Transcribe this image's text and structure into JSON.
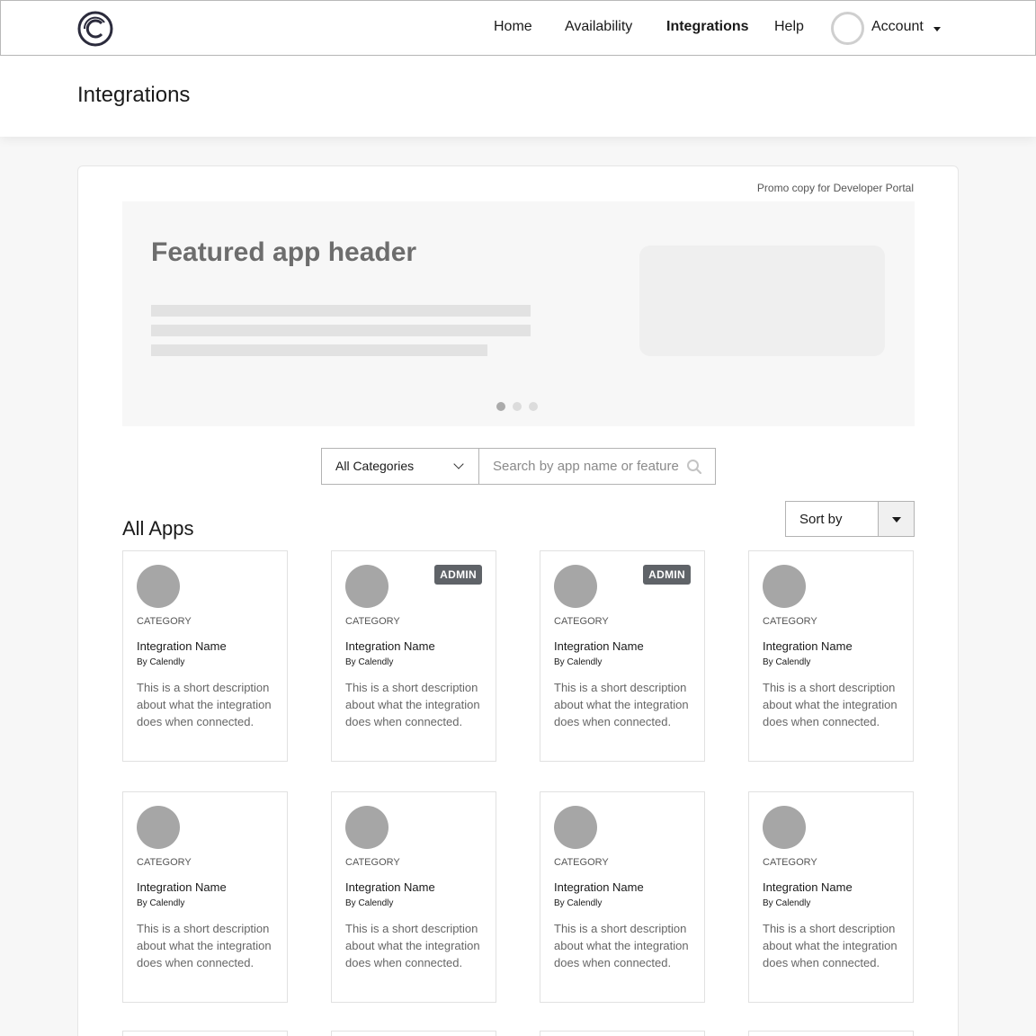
{
  "nav": {
    "items": [
      {
        "label": "Home",
        "active": false
      },
      {
        "label": "Availability",
        "active": false
      },
      {
        "label": "Integrations",
        "active": true
      },
      {
        "label": "Help",
        "active": false
      }
    ],
    "account_label": "Account"
  },
  "header": {
    "title": "Integrations"
  },
  "promo": {
    "copy": "Promo copy for Developer Portal"
  },
  "featured": {
    "header": "Featured app header",
    "slides": 3,
    "active_slide": 1
  },
  "filters": {
    "category_selected": "All Categories",
    "search_placeholder": "Search by app name or feature"
  },
  "apps_section": {
    "title": "All Apps",
    "sort_label": "Sort by"
  },
  "apps": [
    {
      "category": "CATEGORY",
      "name": "Integration Name",
      "by": "By Calendly",
      "description": "This is a short description about what the integration does when connected.",
      "badge": ""
    },
    {
      "category": "CATEGORY",
      "name": "Integration Name",
      "by": "By Calendly",
      "description": "This is a short description about what the integration does when connected.",
      "badge": "ADMIN"
    },
    {
      "category": "CATEGORY",
      "name": "Integration Name",
      "by": "By Calendly",
      "description": "This is a short description about what the integration does when connected.",
      "badge": "ADMIN"
    },
    {
      "category": "CATEGORY",
      "name": "Integration Name",
      "by": "By Calendly",
      "description": "This is a short description about what the integration does when connected.",
      "badge": ""
    },
    {
      "category": "CATEGORY",
      "name": "Integration Name",
      "by": "By Calendly",
      "description": "This is a short description about what the integration does when connected.",
      "badge": ""
    },
    {
      "category": "CATEGORY",
      "name": "Integration Name",
      "by": "By Calendly",
      "description": "This is a short description about what the integration does when connected.",
      "badge": ""
    },
    {
      "category": "CATEGORY",
      "name": "Integration Name",
      "by": "By Calendly",
      "description": "This is a short description about what the integration does when connected.",
      "badge": ""
    },
    {
      "category": "CATEGORY",
      "name": "Integration Name",
      "by": "By Calendly",
      "description": "This is a short description about what the integration does when connected.",
      "badge": ""
    }
  ]
}
